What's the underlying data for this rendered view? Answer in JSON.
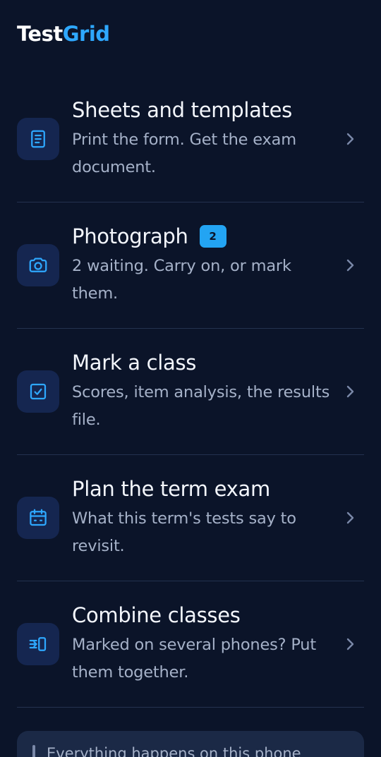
{
  "brand": {
    "part1": "Test",
    "part2": "Grid"
  },
  "colors": {
    "background": "#0b1429",
    "accent": "#2ea8ff",
    "icon_tile": "#152650",
    "divider": "#24324f",
    "muted_text": "#a5b1c8"
  },
  "menu": [
    {
      "title": "Sheets and templates",
      "description": "Print the form. Get the exam document.",
      "icon": "document-icon",
      "badge": ""
    },
    {
      "title": "Photograph",
      "description": "2 waiting. Carry on, or mark them.",
      "icon": "camera-icon",
      "badge": "2"
    },
    {
      "title": "Mark a class",
      "description": "Scores, item analysis, the results file.",
      "icon": "checkbox-icon",
      "badge": ""
    },
    {
      "title": "Plan the term exam",
      "description": "What this term's tests say to revisit.",
      "icon": "calendar-icon",
      "badge": ""
    },
    {
      "title": "Combine classes",
      "description": "Marked on several phones? Put them together.",
      "icon": "merge-icon",
      "badge": ""
    }
  ],
  "notice": {
    "text": "Everything happens on this phone"
  }
}
